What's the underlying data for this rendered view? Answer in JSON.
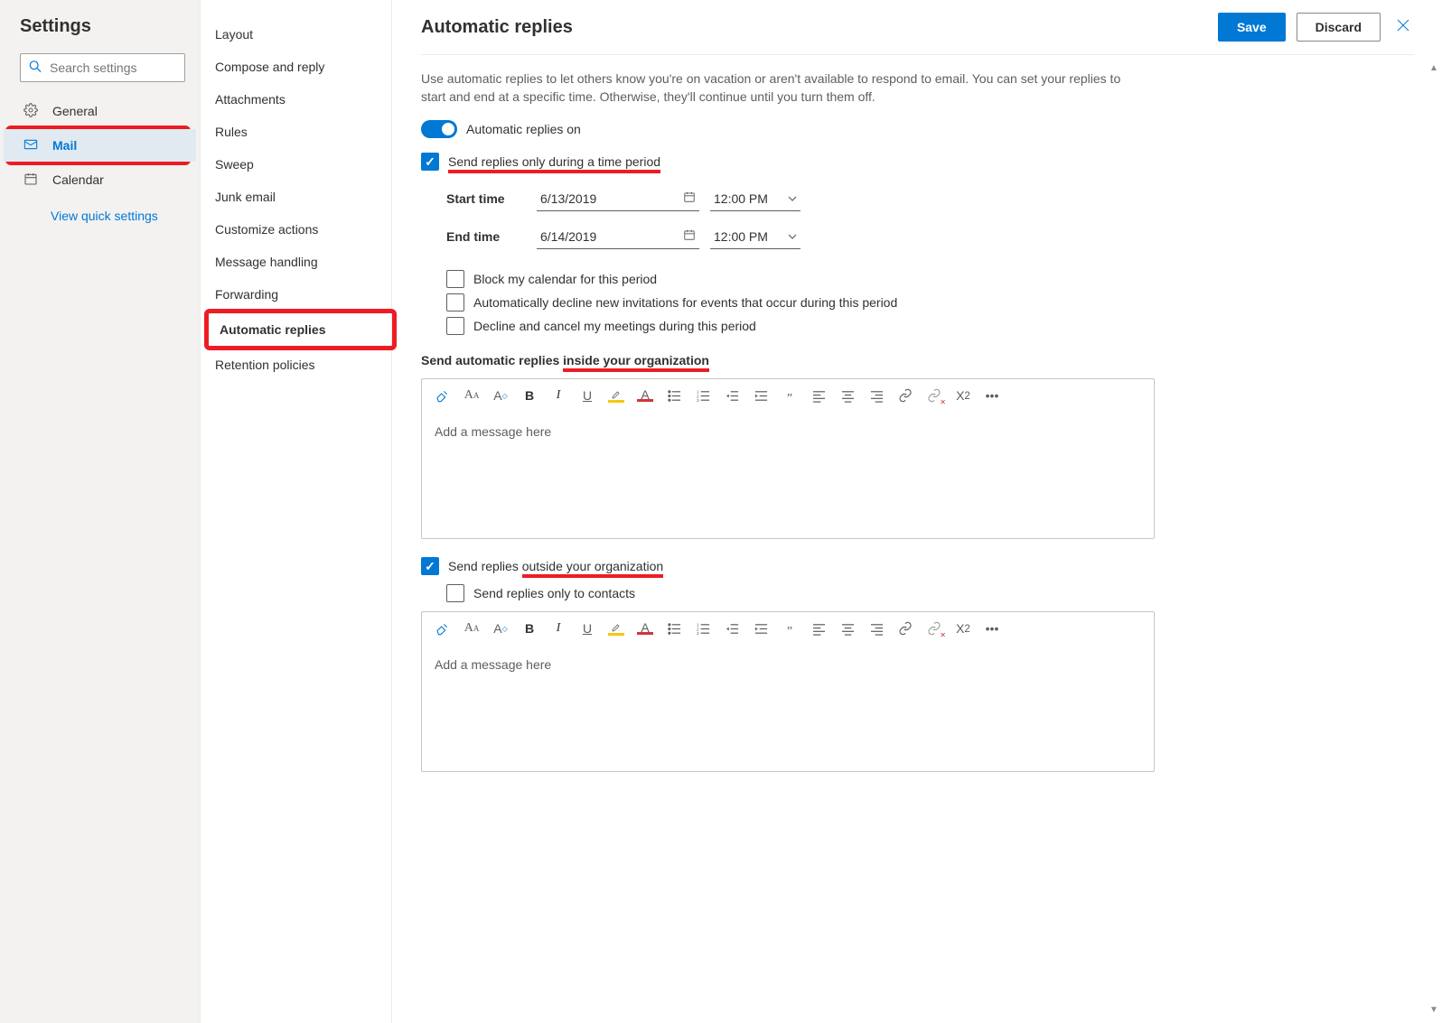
{
  "sidebar": {
    "title": "Settings",
    "search_placeholder": "Search settings",
    "items": [
      {
        "label": "General"
      },
      {
        "label": "Mail"
      },
      {
        "label": "Calendar"
      }
    ],
    "quick_link": "View quick settings"
  },
  "subnav": {
    "items": [
      "Layout",
      "Compose and reply",
      "Attachments",
      "Rules",
      "Sweep",
      "Junk email",
      "Customize actions",
      "Message handling",
      "Forwarding",
      "Automatic replies",
      "Retention policies"
    ]
  },
  "header": {
    "title": "Automatic replies",
    "save": "Save",
    "discard": "Discard"
  },
  "content": {
    "description": "Use automatic replies to let others know you're on vacation or aren't available to respond to email. You can set your replies to start and end at a specific time. Otherwise, they'll continue until you turn them off.",
    "toggle_label": "Automatic replies on",
    "time_period_label": "Send replies only during a time period",
    "start_label": "Start time",
    "start_date": "6/13/2019",
    "start_time": "12:00 PM",
    "end_label": "End time",
    "end_date": "6/14/2019",
    "end_time": "12:00 PM",
    "opt_block": "Block my calendar for this period",
    "opt_decline_new": "Automatically decline new invitations for events that occur during this period",
    "opt_cancel": "Decline and cancel my meetings during this period",
    "inside_head_a": "Send automatic replies ",
    "inside_head_b": "inside your organization",
    "outside_label_a": "Send replies ",
    "outside_label_b": "outside your organization",
    "outside_contacts": "Send replies only to contacts",
    "editor_placeholder": "Add a message here"
  }
}
